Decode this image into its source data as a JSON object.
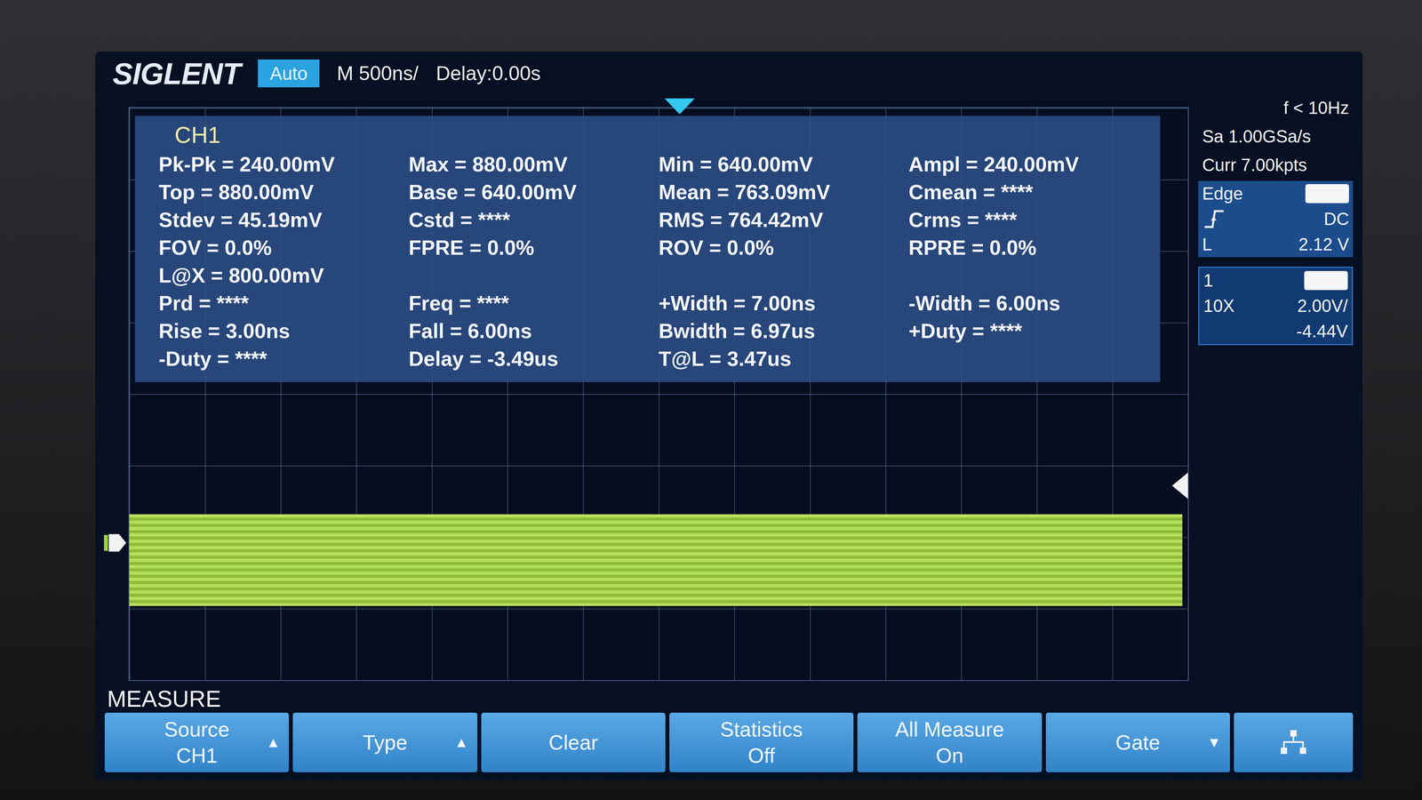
{
  "top_bar": {
    "logo": "SIGLENT",
    "mode": "Auto",
    "timebase": "M 500ns/",
    "delay": "Delay:0.00s"
  },
  "right_panel": {
    "freq": "f < 10Hz",
    "sample_rate": "Sa 1.00GSa/s",
    "memory": "Curr 7.00kpts",
    "trigger_type": "Edge",
    "trigger_coupling": "DC",
    "trigger_level_label": "L",
    "trigger_level": "2.12 V",
    "channel": {
      "number": "1",
      "probe": "10X",
      "scale": "2.00V/",
      "offset": "-4.44V"
    }
  },
  "measure": {
    "source_label": "CH1",
    "rows": [
      [
        "Pk-Pk = 240.00mV",
        "Max = 880.00mV",
        "Min = 640.00mV",
        "Ampl = 240.00mV"
      ],
      [
        "Top = 880.00mV",
        "Base = 640.00mV",
        "Mean = 763.09mV",
        "Cmean = ****"
      ],
      [
        "Stdev = 45.19mV",
        "Cstd = ****",
        "RMS = 764.42mV",
        "Crms = ****"
      ],
      [
        "FOV = 0.0%",
        "FPRE = 0.0%",
        "ROV = 0.0%",
        "RPRE = 0.0%"
      ],
      [
        "L@X = 800.00mV",
        "",
        "",
        ""
      ],
      [
        "Prd = ****",
        "Freq = ****",
        "+Width = 7.00ns",
        "-Width = 6.00ns"
      ],
      [
        "Rise = 3.00ns",
        "Fall = 6.00ns",
        "Bwidth = 6.97us",
        "+Duty = ****"
      ],
      [
        "-Duty = ****",
        "Delay = -3.49us",
        "T@L = 3.47us",
        ""
      ]
    ]
  },
  "menu": {
    "title": "MEASURE",
    "buttons": [
      {
        "kind": "text",
        "label": "Source",
        "value": "CH1",
        "arrow": "▲"
      },
      {
        "kind": "text",
        "label": "Type",
        "value": "",
        "arrow": "▲"
      },
      {
        "kind": "text",
        "label": "Clear",
        "value": "",
        "arrow": ""
      },
      {
        "kind": "text",
        "label": "Statistics",
        "value": "Off",
        "arrow": ""
      },
      {
        "kind": "text",
        "label": "All Measure",
        "value": "On",
        "arrow": ""
      },
      {
        "kind": "text",
        "label": "Gate",
        "value": "",
        "arrow": "▼"
      },
      {
        "kind": "icon",
        "label": "",
        "value": "",
        "arrow": ""
      }
    ]
  }
}
